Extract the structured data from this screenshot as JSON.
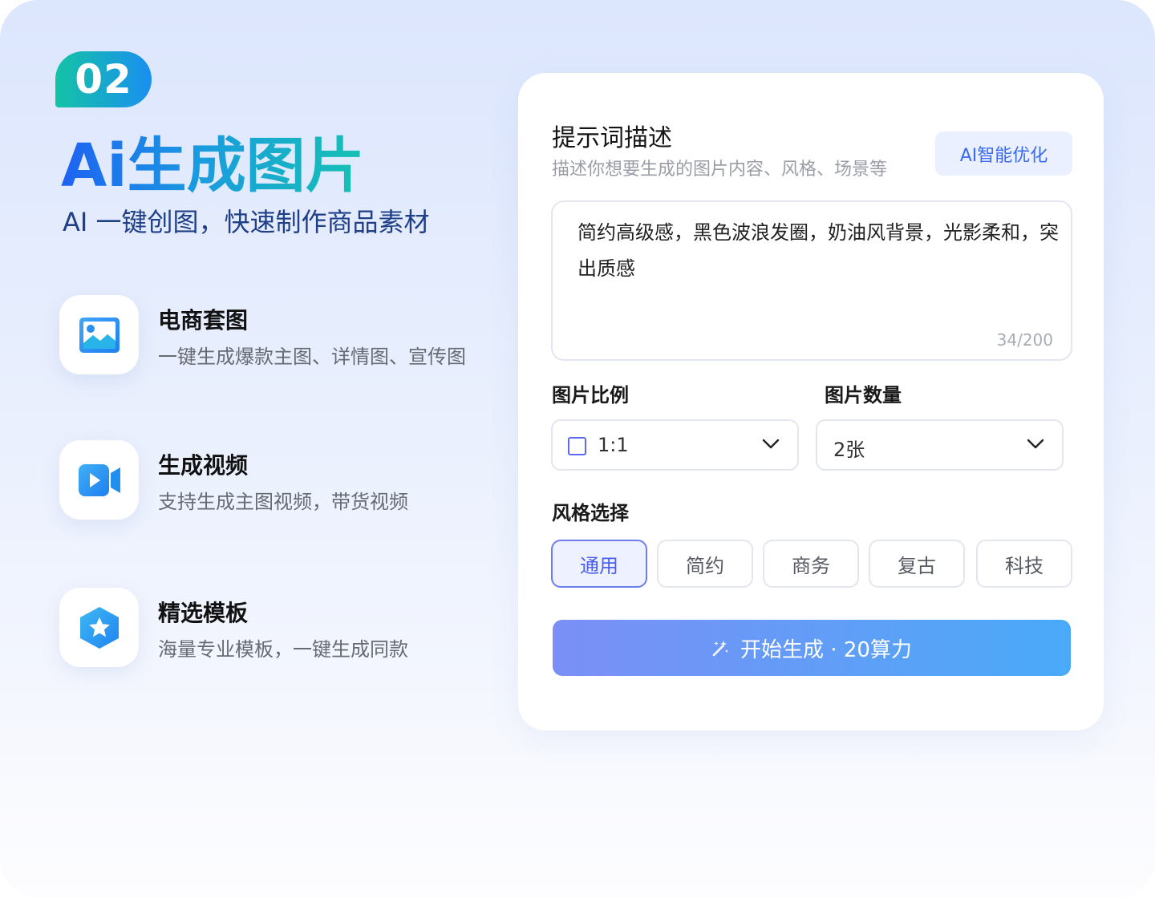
{
  "hero": {
    "badge": "02",
    "title": "Ai生成图片",
    "subtitle": "AI 一键创图，快速制作商品素材"
  },
  "features": [
    {
      "icon": "image-icon",
      "title": "电商套图",
      "desc": "一键生成爆款主图、详情图、宣传图"
    },
    {
      "icon": "video-camera-icon",
      "title": "生成视频",
      "desc": "支持生成主图视频，带货视频"
    },
    {
      "icon": "star-hexagon-icon",
      "title": "精选模板",
      "desc": "海量专业模板，一键生成同款"
    }
  ],
  "panel": {
    "title": "提示词描述",
    "subtitle": "描述你想要生成的图片内容、风格、场景等",
    "ai_button": "AI智能优化",
    "prompt": {
      "value": "简约高级感，黑色波浪发圈，奶油风背景，光影柔和，突出质感",
      "counter": "34/200"
    },
    "ratio": {
      "label": "图片比例",
      "value": "1:1"
    },
    "count": {
      "label": "图片数量",
      "value": "2张"
    },
    "style": {
      "label": "风格选择",
      "options": [
        "通用",
        "简约",
        "商务",
        "复古",
        "科技"
      ],
      "selected": "通用"
    },
    "generate_button": "开始生成 · 20算力"
  },
  "colors": {
    "accent": "#4a5ff0",
    "brand_gradient_start": "#1e62f2",
    "brand_gradient_end": "#15c2b2",
    "button_gradient_start": "#7b8ff6",
    "button_gradient_end": "#4aaaf9"
  }
}
